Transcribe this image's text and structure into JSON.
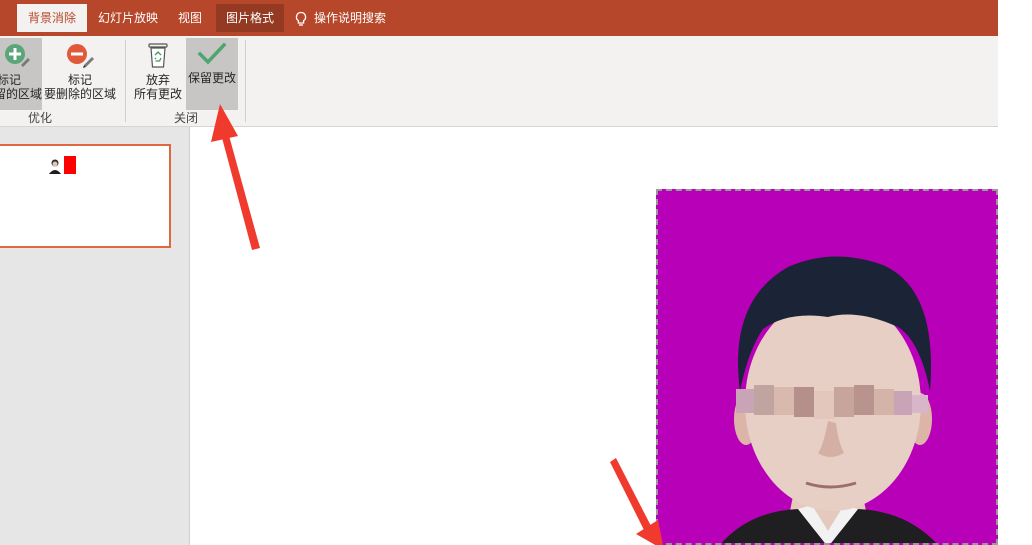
{
  "tabs": [
    {
      "label": "背景消除",
      "active": true
    },
    {
      "label": "幻灯片放映"
    },
    {
      "label": "视图"
    },
    {
      "label": "图片格式",
      "contextual": true
    }
  ],
  "tell_me": {
    "label": "操作说明搜索",
    "icon": "lightbulb-icon"
  },
  "ribbon": {
    "optimize_group": {
      "label": "优化",
      "mark_keep": {
        "line1": "标记",
        "line2": "要保留的区域"
      },
      "mark_remove": {
        "line1": "标记",
        "line2": "要删除的区域"
      }
    },
    "close_group": {
      "label": "关闭",
      "discard": {
        "line1": "放弃",
        "line2": "所有更改"
      },
      "keep": {
        "label": "保留更改"
      }
    }
  },
  "colors": {
    "accent": "#b7472a",
    "photo_background": "#b800b8",
    "thumb_border": "#e0683e",
    "arrow": "#f03a2e"
  }
}
